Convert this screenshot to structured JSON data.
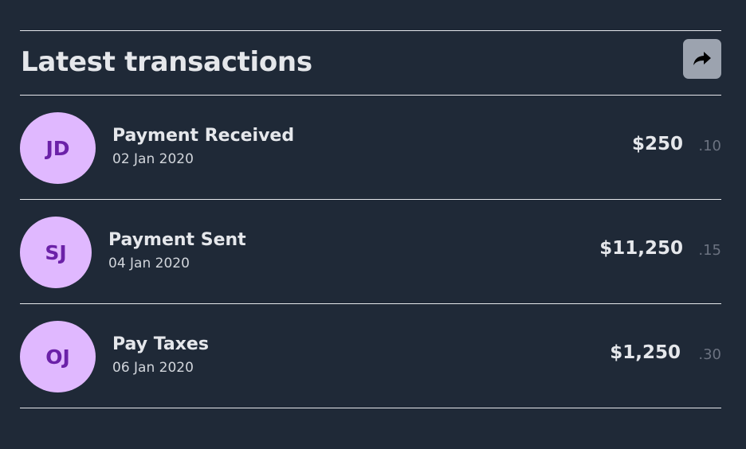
{
  "header": {
    "title": "Latest transactions",
    "share_icon": "share-arrow-icon"
  },
  "colors": {
    "background": "#1f2937",
    "avatar_bg": "#e0b8ff",
    "avatar_text": "#6b21a8",
    "button_bg": "#9ca3af"
  },
  "transactions": [
    {
      "initials": "JD",
      "title": "Payment Received",
      "date": "02 Jan 2020",
      "amount": "$250",
      "cents": ".10"
    },
    {
      "initials": "SJ",
      "title": "Payment Sent",
      "date": "04 Jan 2020",
      "amount": "$11,250",
      "cents": ".15"
    },
    {
      "initials": "OJ",
      "title": "Pay Taxes",
      "date": "06 Jan 2020",
      "amount": "$1,250",
      "cents": ".30"
    }
  ]
}
